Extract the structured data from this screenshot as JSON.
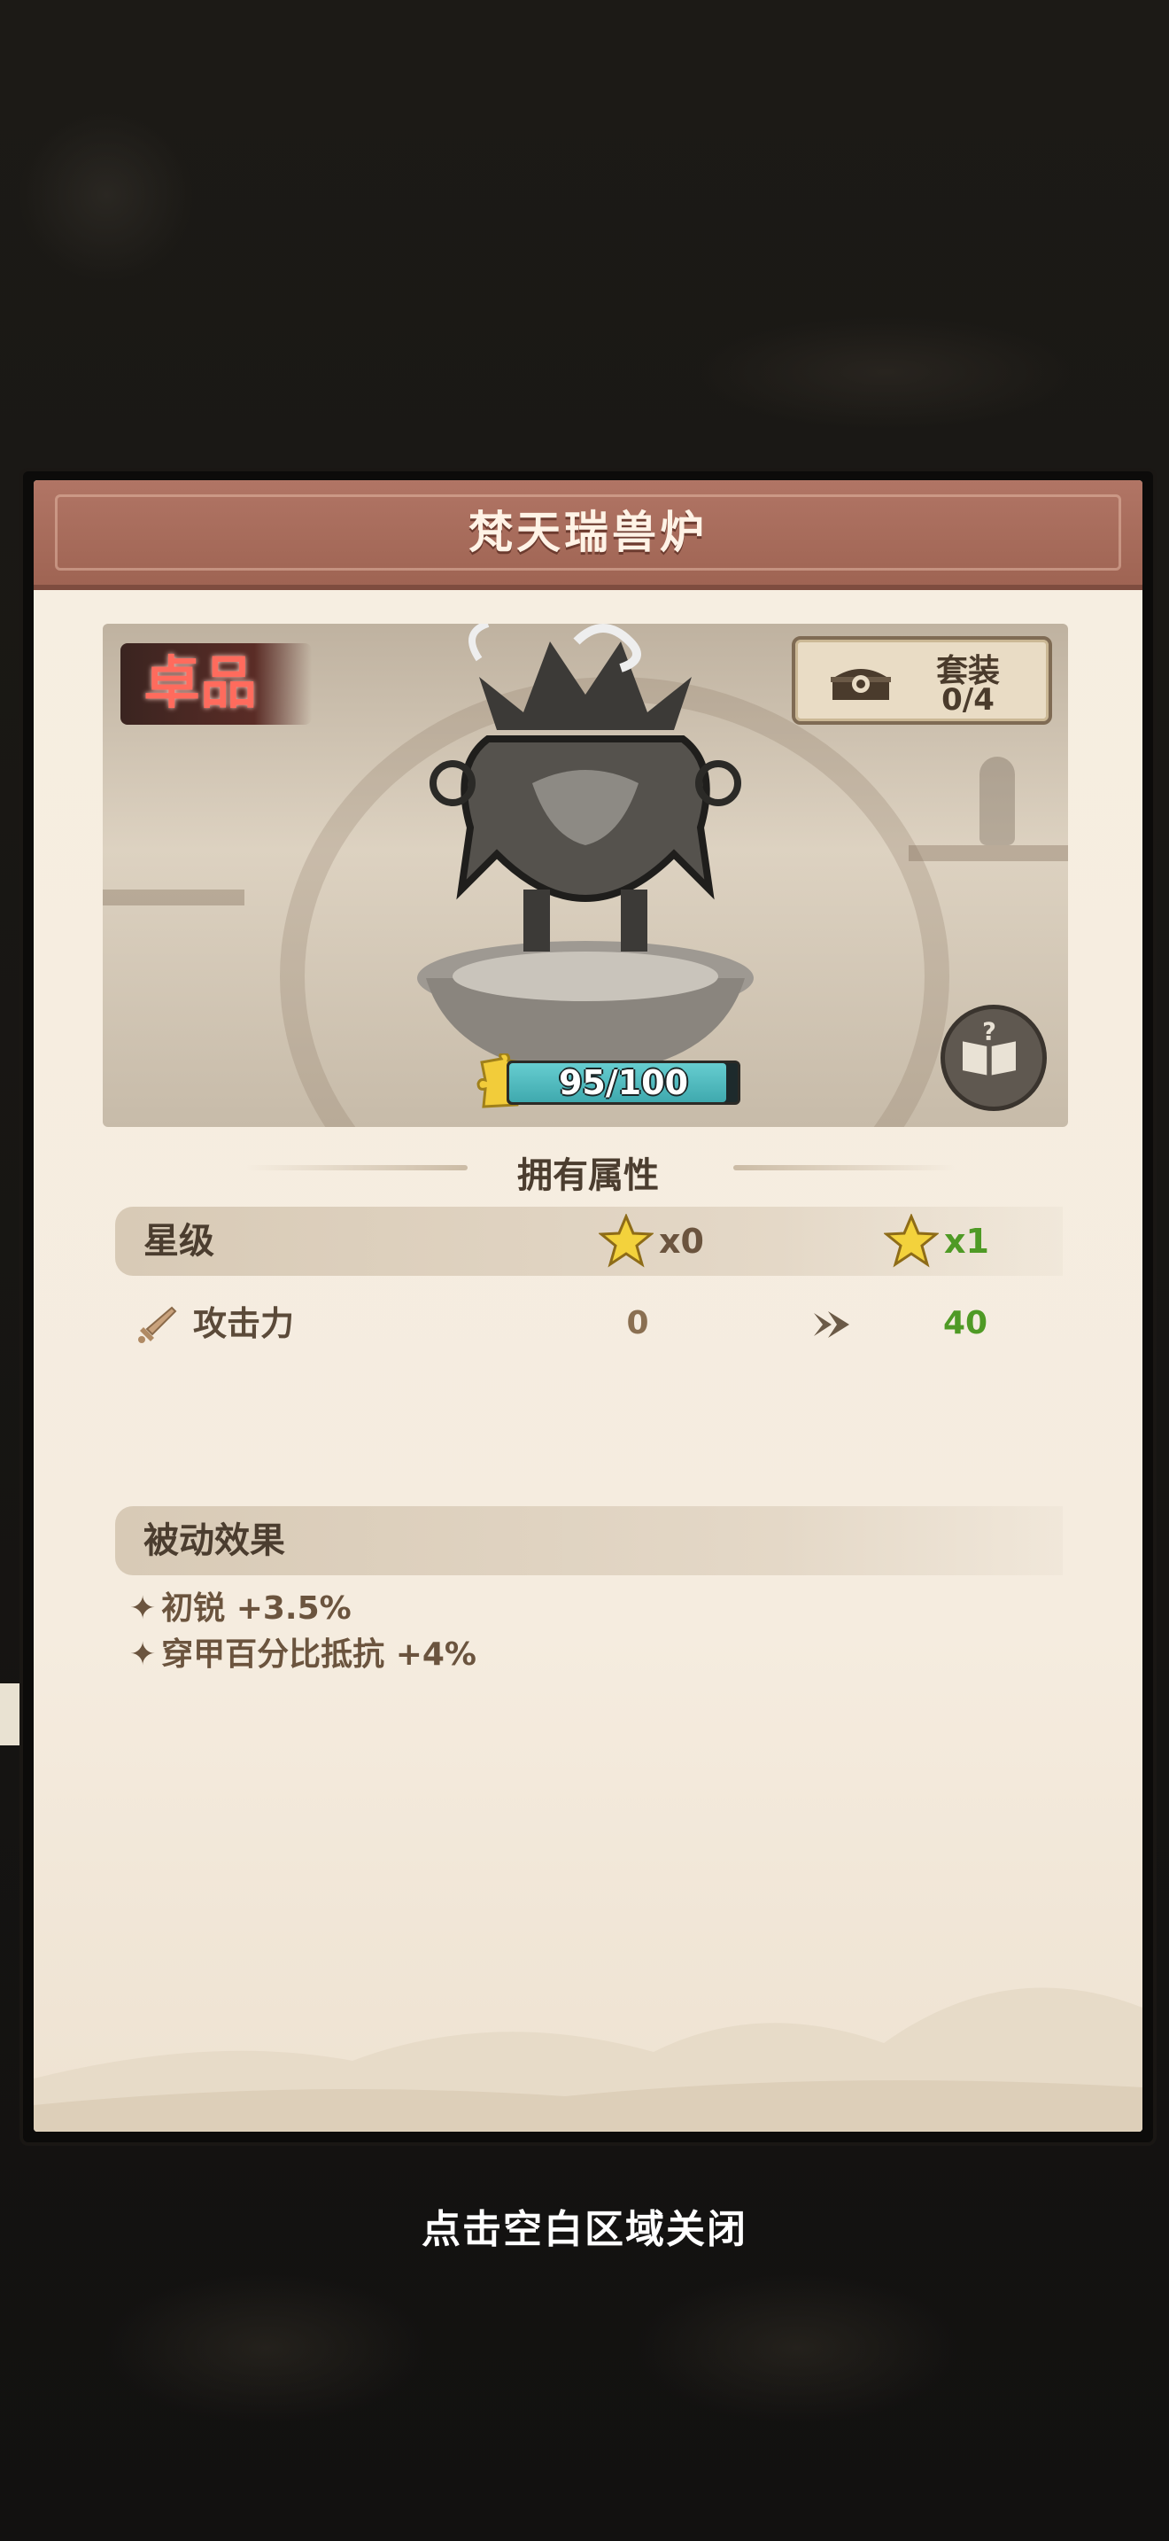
{
  "modal": {
    "title": "梵天瑞兽炉",
    "grade_badge": "卓品",
    "set_button": {
      "label": "套装",
      "count": "0/4"
    },
    "fragments": {
      "text": "95/100",
      "current": 95,
      "required": 100
    },
    "attributes": {
      "section_title": "拥有属性",
      "star_row": {
        "label": "星级",
        "current_star_count": "x0",
        "next_star_count": "x1"
      },
      "stats": [
        {
          "icon": "sword-icon",
          "label": "攻击力",
          "current": "0",
          "next": "40"
        }
      ]
    },
    "passive": {
      "section_title": "被动效果",
      "effects": [
        {
          "text": "初锐 +3.5%"
        },
        {
          "text": "穿甲百分比抵抗 +4%"
        }
      ]
    }
  },
  "close_hint": "点击空白区域关闭",
  "colors": {
    "header": "#a56a59",
    "panel": "#f6eee1",
    "progress_fill": "#52bcc0",
    "next_value": "#4f9a25",
    "grade_red": "#ff6b5d"
  }
}
